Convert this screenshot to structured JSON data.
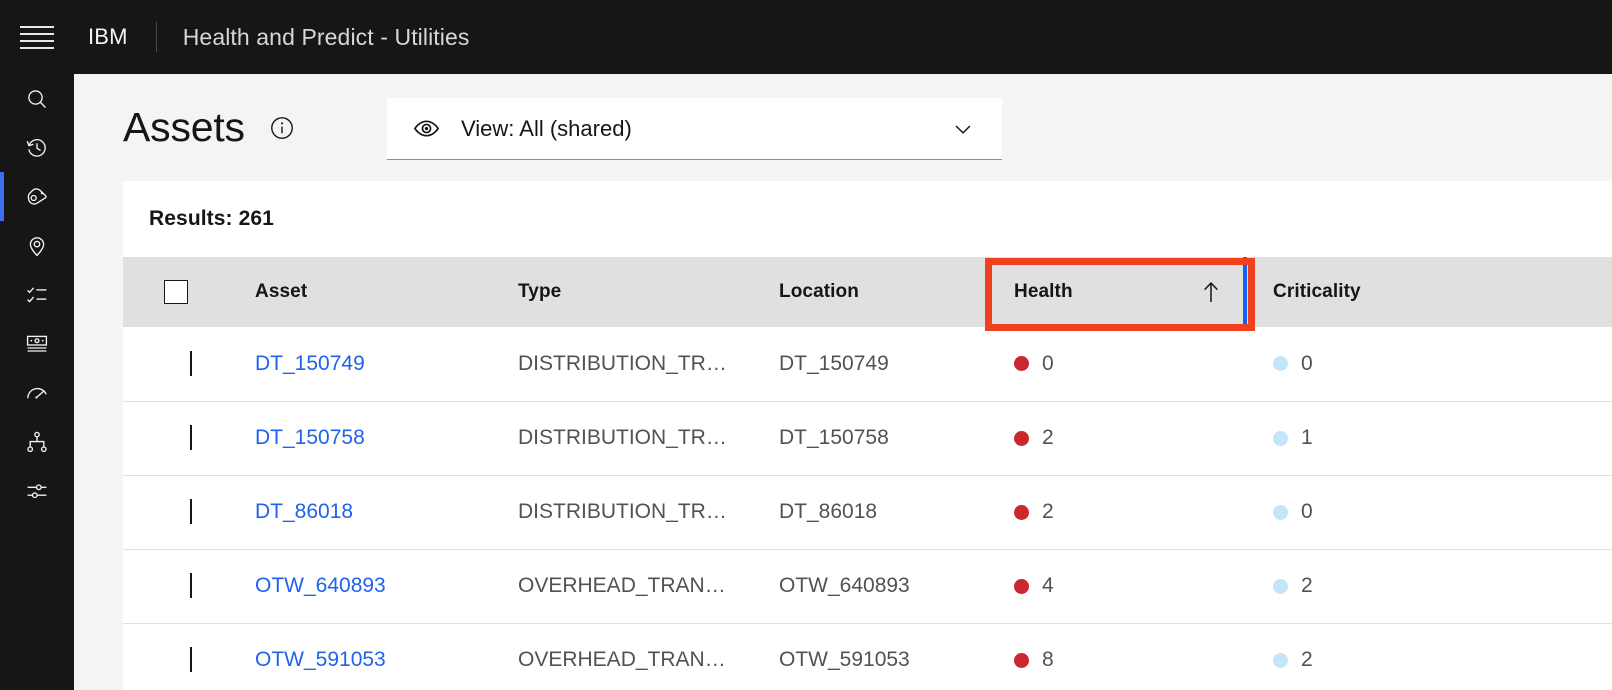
{
  "header": {
    "menu_icon": "hamburger-menu-icon",
    "brand": "IBM",
    "app_title": "Health and Predict - Utilities"
  },
  "sidebar": {
    "items": [
      {
        "icon": "search-icon",
        "name": "search"
      },
      {
        "icon": "history-icon",
        "name": "history"
      },
      {
        "icon": "asset-tag-icon",
        "name": "assets",
        "active": true
      },
      {
        "icon": "location-pin-icon",
        "name": "locations"
      },
      {
        "icon": "checklist-icon",
        "name": "work-orders"
      },
      {
        "icon": "card-icon",
        "name": "inventory"
      },
      {
        "icon": "gauge-icon",
        "name": "meters"
      },
      {
        "icon": "hierarchy-icon",
        "name": "hierarchy"
      },
      {
        "icon": "sliders-icon",
        "name": "settings"
      }
    ],
    "active_indicator_color": "#3d6df0"
  },
  "main": {
    "page_title": "Assets",
    "info_icon": "information-icon",
    "view_select": {
      "icon": "eye-icon",
      "label": "View: All (shared)",
      "chevron": "chevron-down-icon"
    },
    "results_label": "Results: 261",
    "table": {
      "columns": [
        {
          "key": "checkbox",
          "label": ""
        },
        {
          "key": "asset",
          "label": "Asset"
        },
        {
          "key": "type",
          "label": "Type"
        },
        {
          "key": "location",
          "label": "Location"
        },
        {
          "key": "health",
          "label": "Health",
          "sorted": true,
          "sort_icon": "sort-ascending-arrow",
          "highlighted": true
        },
        {
          "key": "criticality",
          "label": "Criticality"
        }
      ],
      "rows": [
        {
          "asset": "DT_150749",
          "type": "DISTRIBUTION_TR…",
          "location": "DT_150749",
          "health": "0",
          "criticality": "0"
        },
        {
          "asset": "DT_150758",
          "type": "DISTRIBUTION_TR…",
          "location": "DT_150758",
          "health": "2",
          "criticality": "1"
        },
        {
          "asset": "DT_86018",
          "type": "DISTRIBUTION_TR…",
          "location": "DT_86018",
          "health": "2",
          "criticality": "0"
        },
        {
          "asset": "OTW_640893",
          "type": "OVERHEAD_TRANS…",
          "location": "OTW_640893",
          "health": "4",
          "criticality": "2"
        },
        {
          "asset": "OTW_591053",
          "type": "OVERHEAD_TRANS…",
          "location": "OTW_591053",
          "health": "8",
          "criticality": "2"
        }
      ]
    }
  },
  "colors": {
    "header_bg": "#161616",
    "page_bg": "#f4f4f4",
    "table_header_bg": "#e0e0e0",
    "health_column_bg": "#cccccc",
    "resize_handle": "#0f62fe",
    "link": "#1f62f0",
    "health_dot": "#c9282d",
    "criticality_dot": "#c3e5fa",
    "annotation_border": "#f0411e"
  }
}
